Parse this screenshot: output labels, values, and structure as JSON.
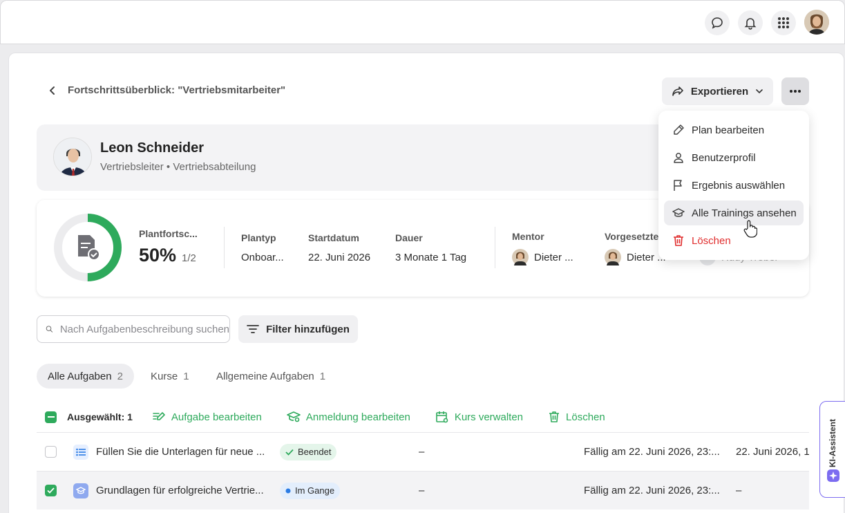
{
  "header": {
    "icons": [
      "chat-icon",
      "bell-icon",
      "apps-grid-icon"
    ]
  },
  "breadcrumb": {
    "title": "Fortschrittsüberblick: \"Vertriebsmitarbeiter\""
  },
  "toolbar": {
    "export_label": "Exportieren"
  },
  "profile": {
    "name": "Leon Schneider",
    "role": "Vertriebsleiter",
    "department": "Vertriebsabteilung",
    "separator": "•"
  },
  "stats": {
    "progress_label": "Plantfortsc...",
    "progress_value": "50%",
    "progress_fraction": "1/2",
    "progress_ratio": 0.5,
    "plan_type_label": "Plantyp",
    "plan_type_value": "Onboar...",
    "start_label": "Startdatum",
    "start_value": "22. Juni 2026",
    "duration_label": "Dauer",
    "duration_value": "3 Monate 1 Tag",
    "mentor_label": "Mentor",
    "mentor_value": "Dieter ...",
    "supervisor_label": "Vorgesetzter",
    "supervisor_value": "Dieter ...",
    "extra_value": "Rudy Treber"
  },
  "search": {
    "placeholder": "Nach Aufgabenbeschreibung suchen"
  },
  "filter": {
    "label": "Filter hinzufügen"
  },
  "tabs": [
    {
      "label": "Alle Aufgaben",
      "count": "2"
    },
    {
      "label": "Kurse",
      "count": "1"
    },
    {
      "label": "Allgemeine Aufgaben",
      "count": "1"
    }
  ],
  "bulk": {
    "selected": "Ausgewählt: 1",
    "edit_task": "Aufgabe bearbeiten",
    "edit_enrollment": "Anmeldung bearbeiten",
    "manage_course": "Kurs verwalten",
    "delete": "Löschen"
  },
  "rows": [
    {
      "title": "Füllen Sie die Unterlagen für neue ...",
      "status": "Beendet",
      "col3": "–",
      "due": "Fällig am 22. Juni 2026, 23:...",
      "done": "22. Juni 2026, 1"
    },
    {
      "title": "Grundlagen für erfolgreiche Vertrie...",
      "status": "Im Gange",
      "col3": "–",
      "due": "Fällig am 22. Juni 2026, 23:...",
      "done": "–"
    }
  ],
  "menu": {
    "edit_plan": "Plan bearbeiten",
    "user_profile": "Benutzerprofil",
    "choose_result": "Ergebnis auswählen",
    "all_trainings": "Alle Trainings ansehen",
    "delete": "Löschen"
  },
  "assistant": {
    "label": "KI-Assistent"
  },
  "colors": {
    "accent_green": "#2eaa5c",
    "danger_red": "#e02d2d",
    "assistant_purple": "#7c6cf0",
    "progress_blue": "#2a7be4"
  }
}
